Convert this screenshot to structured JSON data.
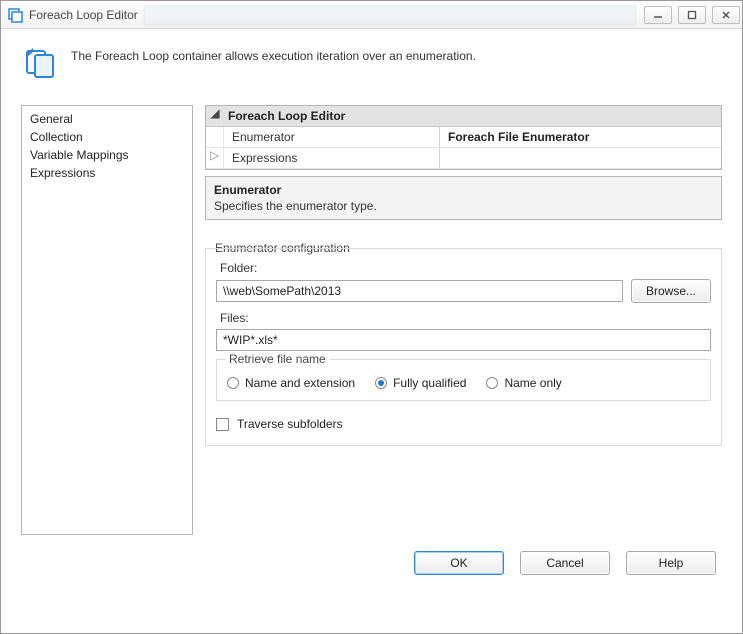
{
  "window": {
    "title": "Foreach Loop Editor"
  },
  "header": {
    "description": "The Foreach Loop container allows execution iteration over an enumeration."
  },
  "nav": {
    "items": [
      "General",
      "Collection",
      "Variable Mappings",
      "Expressions"
    ]
  },
  "propgrid": {
    "section": "Foreach Loop Editor",
    "rows": {
      "enumerator": {
        "name": "Enumerator",
        "value": "Foreach File Enumerator"
      },
      "expressions": {
        "name": "Expressions",
        "value": ""
      }
    }
  },
  "descblock": {
    "title": "Enumerator",
    "text": "Specifies the enumerator type."
  },
  "config": {
    "legend": "Enumerator configuration",
    "folder_label": "Folder:",
    "folder_value": "\\\\web\\SomePath\\2013",
    "browse_label": "Browse...",
    "files_label": "Files:",
    "files_value": "*WIP*.xls*",
    "retrieve_legend": "Retrieve file name",
    "radios": {
      "name_ext": "Name and extension",
      "fully": "Fully qualified",
      "name_only": "Name only",
      "selected": "fully"
    },
    "traverse_label": "Traverse subfolders",
    "traverse_checked": false
  },
  "footer": {
    "ok": "OK",
    "cancel": "Cancel",
    "help": "Help"
  }
}
